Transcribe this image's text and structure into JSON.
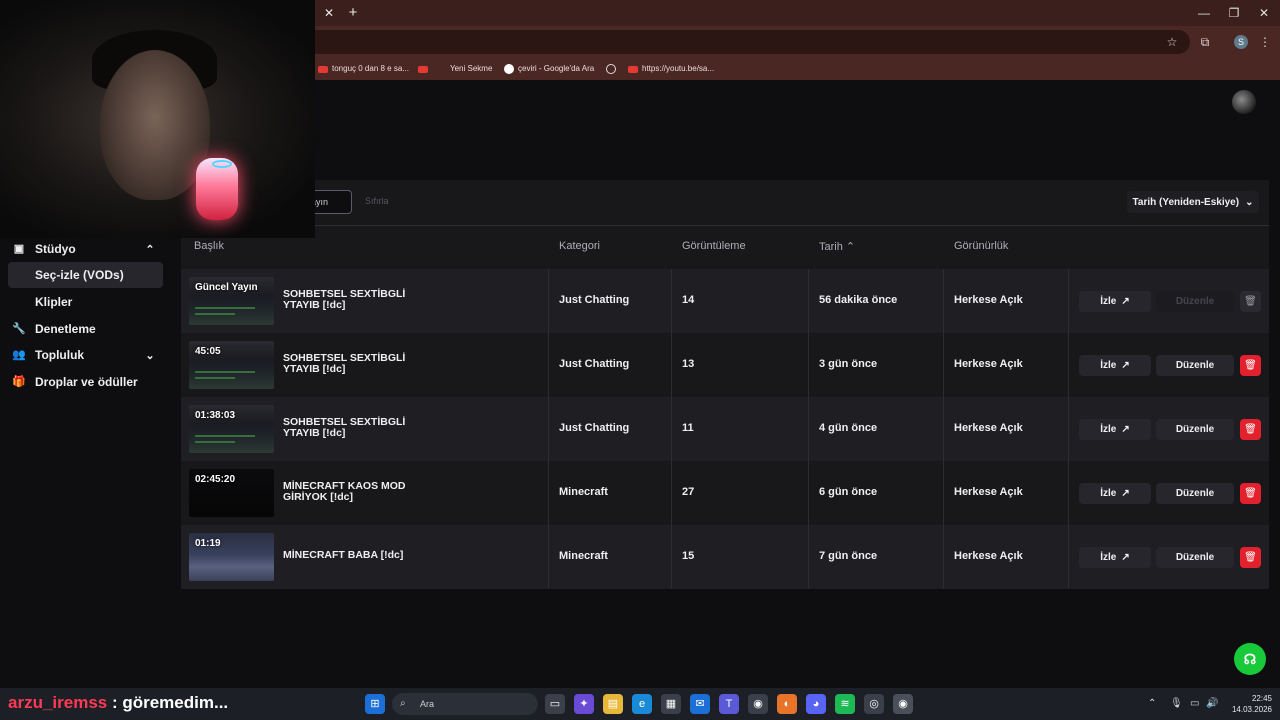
{
  "browser": {
    "tab_close": "✕",
    "tab_new": "+",
    "bookmarks": [
      {
        "label": "tonguç 0 dan 8 e sa...",
        "icon": "youtube-icon"
      },
      {
        "label": "",
        "icon": "youtube-icon"
      },
      {
        "label": "Yeni Sekme",
        "icon": "blank-page-icon"
      },
      {
        "label": "çeviri - Google'da Ara",
        "icon": "google-icon"
      },
      {
        "label": "",
        "icon": "globe-icon"
      },
      {
        "label": "https://youtu.be/sa...",
        "icon": "youtube-icon"
      }
    ],
    "profile_letter": "S"
  },
  "toolbar": {
    "filter_value": "ayın",
    "filter_clear": "Sıfırla",
    "sort_label": "Tarih (Yeniden-Eskiye)"
  },
  "sidebar": {
    "items": [
      {
        "label": "Stüdyo",
        "icon": "video-icon",
        "chevron": "up"
      },
      {
        "label": "Seç-izle (VODs)",
        "active": true
      },
      {
        "label": "Klipler"
      },
      {
        "label": "Denetleme",
        "icon": "wrench-icon"
      },
      {
        "label": "Topluluk",
        "icon": "people-icon",
        "chevron": "down"
      },
      {
        "label": "Droplar ve ödüller",
        "icon": "gift-icon"
      }
    ]
  },
  "table": {
    "headers": {
      "title": "Başlık",
      "category": "Kategori",
      "views": "Görüntüleme",
      "date": "Tarih",
      "visibility": "Görünürlük"
    },
    "rows": [
      {
        "duration": "Güncel Yayın",
        "title": "SOHBETSEL SEXTİBGLİ YTAYIB [!dc]",
        "category": "Just Chatting",
        "views": "14",
        "date": "56 dakika önce",
        "visibility": "Herkese Açık",
        "watch": "İzle",
        "edit": "Düzenle",
        "live": true
      },
      {
        "duration": "45:05",
        "title": "SOHBETSEL SEXTİBGLİ YTAYIB [!dc]",
        "category": "Just Chatting",
        "views": "13",
        "date": "3 gün önce",
        "visibility": "Herkese Açık",
        "watch": "İzle",
        "edit": "Düzenle"
      },
      {
        "duration": "01:38:03",
        "title": "SOHBETSEL SEXTİBGLİ YTAYIB [!dc]",
        "category": "Just Chatting",
        "views": "11",
        "date": "4 gün önce",
        "visibility": "Herkese Açık",
        "watch": "İzle",
        "edit": "Düzenle"
      },
      {
        "duration": "02:45:20",
        "title": "MİNECRAFT KAOS MOD GİRİYOK [!dc]",
        "category": "Minecraft",
        "views": "27",
        "date": "6 gün önce",
        "visibility": "Herkese Açık",
        "watch": "İzle",
        "edit": "Düzenle"
      },
      {
        "duration": "01:19",
        "title": "MİNECRAFT BABA [!dc]",
        "category": "Minecraft",
        "views": "15",
        "date": "7 gün önce",
        "visibility": "Herkese Açık",
        "watch": "İzle",
        "edit": "Düzenle"
      }
    ]
  },
  "overlay": {
    "chat_user": "arzu_iremss",
    "chat_message": " : göremedim..."
  },
  "taskbar": {
    "search_placeholder": "Ara",
    "time": "22:45",
    "date": "14.03.2026"
  },
  "colors": {
    "accent_delete": "#e3202d",
    "help_button": "#18c93a",
    "chat_user": "#ff3a55"
  }
}
